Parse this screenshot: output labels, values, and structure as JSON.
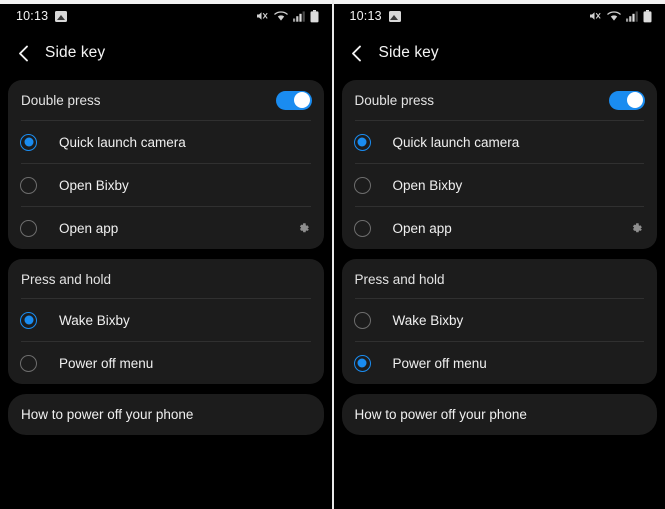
{
  "status_bar": {
    "time": "10:13",
    "photo_icon": "photo-icon",
    "mute_icon": "mute-icon",
    "wifi_icon": "wifi-icon",
    "signal_icon": "signal-icon",
    "battery_icon": "battery-icon"
  },
  "app_bar": {
    "back_icon": "back-chevron-icon",
    "title": "Side key"
  },
  "colors": {
    "accent": "#1a8cf0",
    "card_bg": "#1c1c1c",
    "page_bg": "#000000",
    "text": "#f0f0f0",
    "divider": "#303030"
  },
  "panels": [
    {
      "id": "left",
      "double_press": {
        "header": "Double press",
        "toggle_state": "on",
        "options": [
          {
            "label": "Quick launch camera",
            "selected": true,
            "gear": false
          },
          {
            "label": "Open Bixby",
            "selected": false,
            "gear": false
          },
          {
            "label": "Open app",
            "selected": false,
            "gear": true,
            "gear_icon": "gear-icon"
          }
        ]
      },
      "press_and_hold": {
        "header": "Press and hold",
        "options": [
          {
            "label": "Wake Bixby",
            "selected": true
          },
          {
            "label": "Power off menu",
            "selected": false
          }
        ]
      },
      "help_link": "How to power off your phone"
    },
    {
      "id": "right",
      "double_press": {
        "header": "Double press",
        "toggle_state": "on",
        "options": [
          {
            "label": "Quick launch camera",
            "selected": true,
            "gear": false
          },
          {
            "label": "Open Bixby",
            "selected": false,
            "gear": false
          },
          {
            "label": "Open app",
            "selected": false,
            "gear": true,
            "gear_icon": "gear-icon"
          }
        ]
      },
      "press_and_hold": {
        "header": "Press and hold",
        "options": [
          {
            "label": "Wake Bixby",
            "selected": false
          },
          {
            "label": "Power off menu",
            "selected": true
          }
        ]
      },
      "help_link": "How to power off your phone"
    }
  ]
}
